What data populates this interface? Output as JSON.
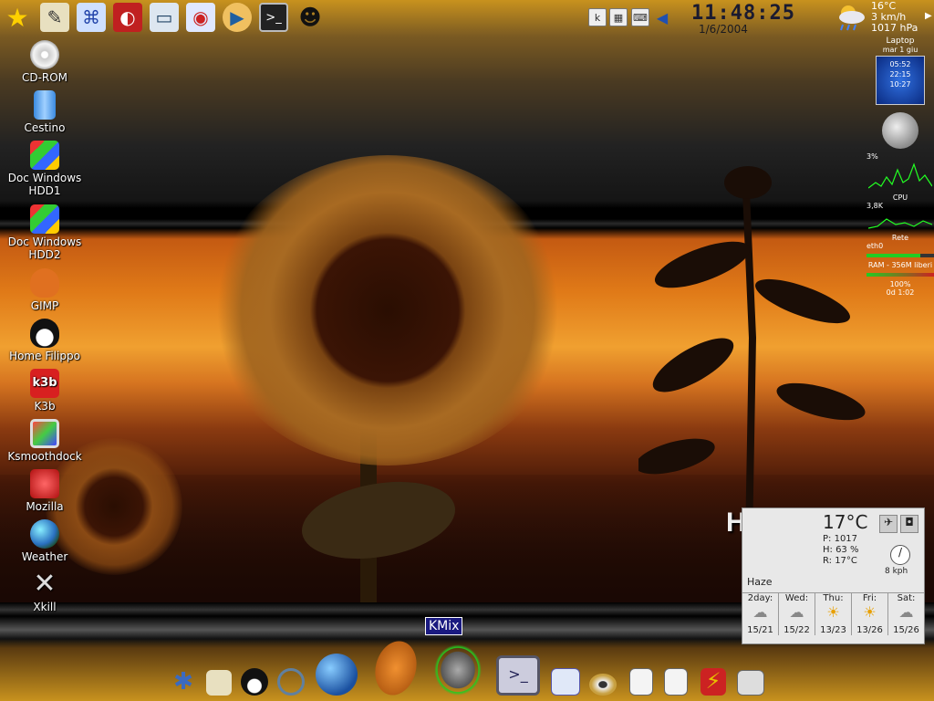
{
  "desktop": {
    "icons": [
      {
        "label": "CD-ROM",
        "icon": "cdrom-icon"
      },
      {
        "label": "Cestino",
        "icon": "trash-icon"
      },
      {
        "label": "Doc Windows HDD1",
        "icon": "windows-drive-icon"
      },
      {
        "label": "Doc Windows HDD2",
        "icon": "windows-drive-icon"
      },
      {
        "label": "GIMP",
        "icon": "gimp-icon"
      },
      {
        "label": "Home Filippo",
        "icon": "tux-home-icon"
      },
      {
        "label": "K3b",
        "icon": "k3b-icon"
      },
      {
        "label": "Ksmoothdock",
        "icon": "ksmoothdock-icon"
      },
      {
        "label": "Mozilla",
        "icon": "mozilla-icon"
      },
      {
        "label": "Weather",
        "icon": "globe-icon"
      },
      {
        "label": "Xkill",
        "icon": "xkill-icon"
      }
    ]
  },
  "top_panel": {
    "launchers": [
      "kde-star-icon",
      "user-tools-icon",
      "network-icon",
      "mozilla-icon",
      "monitor-icon",
      "remote-desktop-icon",
      "media-player-icon",
      "terminal-icon",
      "tux-alien-icon"
    ],
    "clock": "11:48:25",
    "date": "1/6/2004",
    "tray": [
      "clipboard-icon",
      "calendar-icon",
      "keyboard-icon",
      "speaker-icon"
    ],
    "weather": {
      "temp": "16°C",
      "wind": "3 km/h",
      "pressure": "1017 hPa"
    }
  },
  "sidebar": {
    "laptop_label": "Laptop",
    "day_label": "mar 1 giu",
    "times": [
      "05:52",
      "22:15",
      "10:27"
    ],
    "cpu_pct": "3%",
    "cpu_label": "CPU",
    "net_val": "3,8K",
    "net_label": "Rete",
    "ether_label": "eth0",
    "mem_label": "RAM - 356M liberi",
    "battery": "100%",
    "uptime": "0d 1:02"
  },
  "weather_widget": {
    "title": "HAZE",
    "temp": "17°C",
    "pressure": "P: 1017",
    "humidity": "H: 63 %",
    "realfeel": "R: 17°C",
    "wind": "8 kph",
    "condition": "Haze",
    "forecast": [
      {
        "day": "2day:",
        "range": "15/21"
      },
      {
        "day": "Wed:",
        "range": "15/22"
      },
      {
        "day": "Thu:",
        "range": "13/23"
      },
      {
        "day": "Fri:",
        "range": "13/26"
      },
      {
        "day": "Sat:",
        "range": "15/26"
      }
    ]
  },
  "kmix_tooltip": "KMix",
  "dock": [
    "kde-gear-icon",
    "user-tools-icon",
    "tux-icon",
    "search-icon",
    "network-globe-icon",
    "coffee-bean-icon",
    "speaker-wifi-icon",
    "monitor-terminal-icon",
    "calendar-globe-icon",
    "eye-icon",
    "chart-icon",
    "document-icon",
    "flash-icon",
    "printer-icon"
  ]
}
